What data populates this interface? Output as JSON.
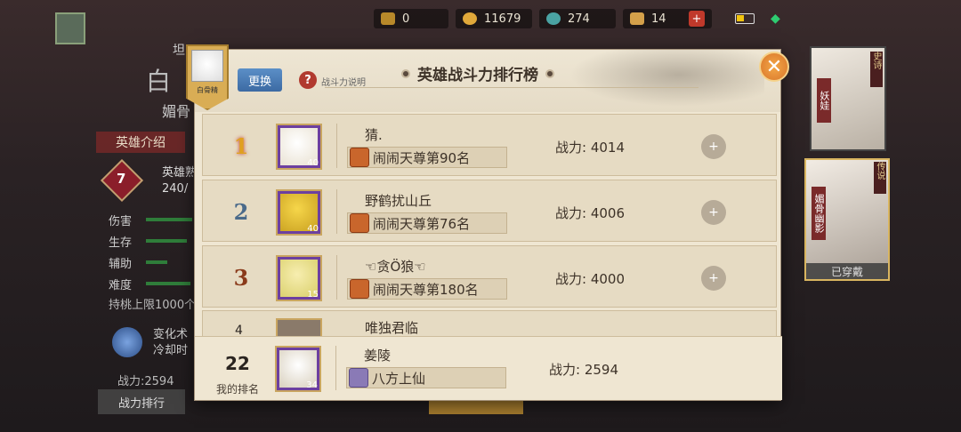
{
  "status": {
    "res1": "0",
    "res2": "11679",
    "res3": "274",
    "res4": "14",
    "plus": "+"
  },
  "background": {
    "hero_small": "坦",
    "hero_big": "白",
    "hero_sub": "媚骨",
    "intro_tab": "英雄介绍",
    "rank_num": "7",
    "hero_stat_line1": "英雄熟",
    "hero_stat_line2": "240/",
    "stats": [
      "伤害",
      "生存",
      "辅助",
      "难度"
    ],
    "peach": "持桃上限1000个",
    "skill_line1": "变化术",
    "skill_line2": "冷却时",
    "power_left": "战力:2594",
    "power_rank_tab": "战力排行",
    "card1_tag": "妖娃",
    "card1_tag2": "史诗",
    "card2_tag": "媚骨幽影",
    "card2_tag2": "传说",
    "card2_worn": "已穿戴"
  },
  "modal": {
    "avatar_label": "白骨精",
    "swap_button": "更换",
    "help_icon": "?",
    "help_text": "战斗力说明",
    "title": "英雄战斗力排行榜",
    "close": "✕"
  },
  "rows": [
    {
      "rank": "1",
      "name": "猜.",
      "level": "40",
      "title": "闹闹天尊第90名",
      "power": "战力: 4014"
    },
    {
      "rank": "2",
      "name": "野鹤扰山丘",
      "level": "40",
      "title": "闹闹天尊第76名",
      "power": "战力: 4006"
    },
    {
      "rank": "3",
      "name": "☜贪Ö狼☜",
      "level": "15",
      "title": "闹闹天尊第180名",
      "power": "战力: 4000"
    }
  ],
  "partial_row": {
    "rank": "4",
    "name": "唯独君临"
  },
  "my_row": {
    "rank": "22",
    "rank_label": "我的排名",
    "name": "姜陵",
    "level": "34",
    "title": "八方上仙",
    "power": "战力: 2594"
  }
}
